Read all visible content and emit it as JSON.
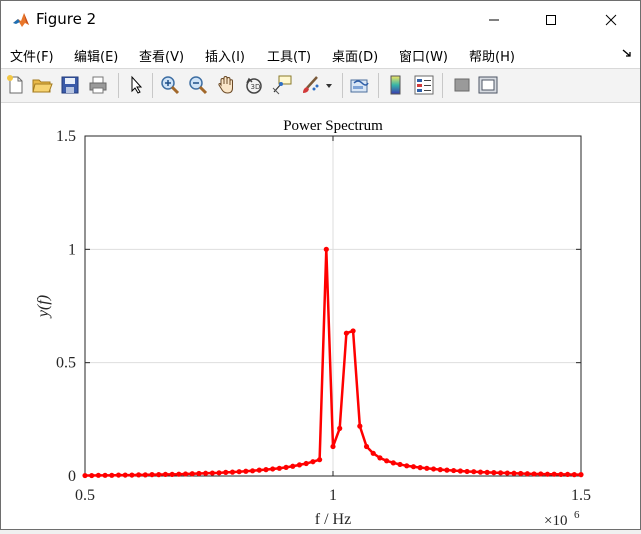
{
  "window": {
    "title": "Figure 2",
    "controls": {
      "minimize": "minimize",
      "maximize": "maximize",
      "close": "close"
    }
  },
  "menu": {
    "items": [
      {
        "label": "文件(F)"
      },
      {
        "label": "编辑(E)"
      },
      {
        "label": "查看(V)"
      },
      {
        "label": "插入(I)"
      },
      {
        "label": "工具(T)"
      },
      {
        "label": "桌面(D)"
      },
      {
        "label": "窗口(W)"
      },
      {
        "label": "帮助(H)"
      }
    ]
  },
  "toolbar": {
    "icons": [
      "new-figure-icon",
      "open-file-icon",
      "save-icon",
      "print-icon",
      "select-arrow-icon",
      "zoom-in-icon",
      "zoom-out-icon",
      "pan-hand-icon",
      "rotate-3d-icon",
      "data-cursor-icon",
      "brush-icon",
      "brush-dropdown-icon",
      "link-plot-icon",
      "colorbar-icon",
      "legend-icon",
      "hide-plot-tools-icon",
      "show-plot-tools-icon"
    ]
  },
  "colors": {
    "series": "#ff0000",
    "grid": "#dedede",
    "axis": "#262626"
  },
  "chart_data": {
    "type": "line",
    "title": "Power Spectrum",
    "xlabel": "f / Hz",
    "ylabel": "y(f)",
    "x_exponent_label": "×10",
    "x_exponent": "6",
    "xlim": [
      0.5,
      1.5
    ],
    "ylim": [
      0,
      1.5
    ],
    "xticks": [
      0.5,
      1,
      1.5
    ],
    "xtick_labels": [
      "0.5",
      "1",
      "1.5"
    ],
    "yticks": [
      0,
      0.5,
      1,
      1.5
    ],
    "ytick_labels": [
      "0",
      "0.5",
      "1",
      "1.5"
    ],
    "grid": true,
    "series": [
      {
        "marker": "dot",
        "x": [
          0.5,
          0.5135,
          0.527,
          0.5405,
          0.554,
          0.5676,
          0.5811,
          0.5946,
          0.6081,
          0.6216,
          0.6351,
          0.6486,
          0.6622,
          0.6757,
          0.6892,
          0.7027,
          0.7162,
          0.7297,
          0.7432,
          0.7568,
          0.7703,
          0.7838,
          0.7973,
          0.8108,
          0.8243,
          0.8378,
          0.8514,
          0.8649,
          0.8784,
          0.8919,
          0.9054,
          0.9189,
          0.9324,
          0.9459,
          0.9595,
          0.973,
          0.9865,
          1.0,
          1.0135,
          1.027,
          1.0405,
          1.0541,
          1.0676,
          1.0811,
          1.0946,
          1.1081,
          1.1216,
          1.1351,
          1.1486,
          1.1622,
          1.1757,
          1.1892,
          1.2027,
          1.2162,
          1.2297,
          1.2432,
          1.2568,
          1.2703,
          1.2838,
          1.2973,
          1.3108,
          1.3243,
          1.3378,
          1.3514,
          1.3649,
          1.3784,
          1.3919,
          1.4054,
          1.4189,
          1.4324,
          1.4459,
          1.4595,
          1.473,
          1.4865,
          1.5
        ],
        "y": [
          0.002,
          0.002,
          0.003,
          0.003,
          0.003,
          0.004,
          0.004,
          0.004,
          0.005,
          0.005,
          0.006,
          0.006,
          0.007,
          0.007,
          0.008,
          0.009,
          0.01,
          0.011,
          0.012,
          0.013,
          0.014,
          0.016,
          0.017,
          0.019,
          0.021,
          0.023,
          0.026,
          0.028,
          0.031,
          0.034,
          0.038,
          0.043,
          0.049,
          0.055,
          0.063,
          0.072,
          1.0,
          0.13,
          0.21,
          0.63,
          0.64,
          0.22,
          0.13,
          0.1,
          0.08,
          0.067,
          0.058,
          0.051,
          0.045,
          0.041,
          0.037,
          0.034,
          0.031,
          0.028,
          0.026,
          0.024,
          0.022,
          0.02,
          0.019,
          0.017,
          0.016,
          0.015,
          0.014,
          0.013,
          0.012,
          0.011,
          0.01,
          0.009,
          0.009,
          0.008,
          0.008,
          0.007,
          0.007,
          0.006,
          0.006
        ]
      }
    ]
  }
}
